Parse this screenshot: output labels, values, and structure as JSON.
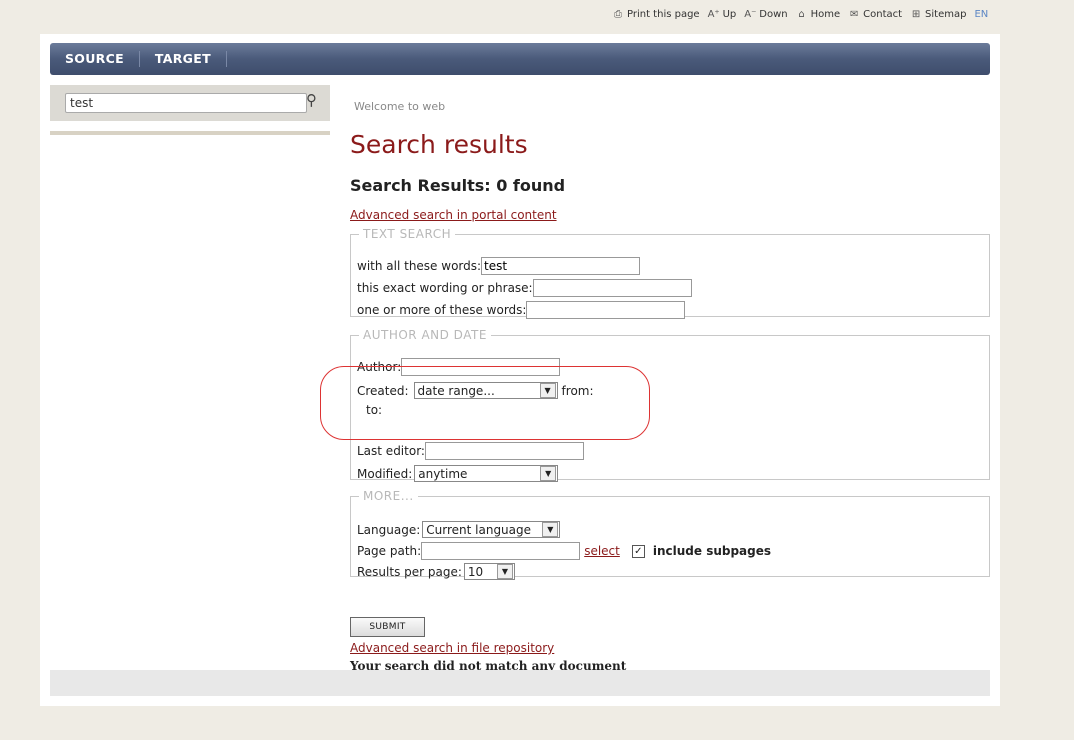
{
  "utility_bar": {
    "print": "Print this page",
    "up": "Up",
    "down": "Down",
    "home": "Home",
    "contact": "Contact",
    "sitemap": "Sitemap",
    "lang": "EN"
  },
  "nav": {
    "tabs": [
      "SOURCE",
      "TARGET"
    ]
  },
  "sidebar": {
    "search_value": "test"
  },
  "main": {
    "welcome": "Welcome to web",
    "title": "Search results",
    "count": "Search Results: 0 found",
    "adv_portal": "Advanced search in portal content",
    "text_search": {
      "legend": "TEXT SEARCH",
      "all_words_label": "with all these words:",
      "all_words_value": "test",
      "exact_label": "this exact wording or phrase:",
      "exact_value": "",
      "any_label": "one or more of these words:",
      "any_value": ""
    },
    "author_date": {
      "legend": "AUTHOR AND DATE",
      "author_label": "Author:",
      "author_value": "",
      "created_label": "Created:",
      "created_value": "date range...",
      "from_label": "from:",
      "to_label": "to:",
      "last_editor_label": "Last editor:",
      "last_editor_value": "",
      "modified_label": "Modified:",
      "modified_value": "anytime"
    },
    "more": {
      "legend": "MORE...",
      "language_label": "Language:",
      "language_value": "Current language",
      "path_label": "Page path:",
      "path_value": "",
      "select_link": "select",
      "include_label": "include subpages",
      "include_checked": true,
      "results_label": "Results per page:",
      "results_value": "10"
    },
    "submit": "SUBMIT",
    "adv_file": "Advanced search in file repository",
    "no_match": "Your search did not match any document"
  },
  "colors": {
    "accent": "#8b1a1a",
    "nav": "#4a5a7a",
    "highlight": "#dd3333"
  },
  "icons": [
    "printer-icon",
    "font-up-icon",
    "font-down-icon",
    "home-icon",
    "mail-icon",
    "sitemap-icon",
    "search-icon",
    "dropdown-arrow-icon",
    "checkbox-icon"
  ]
}
